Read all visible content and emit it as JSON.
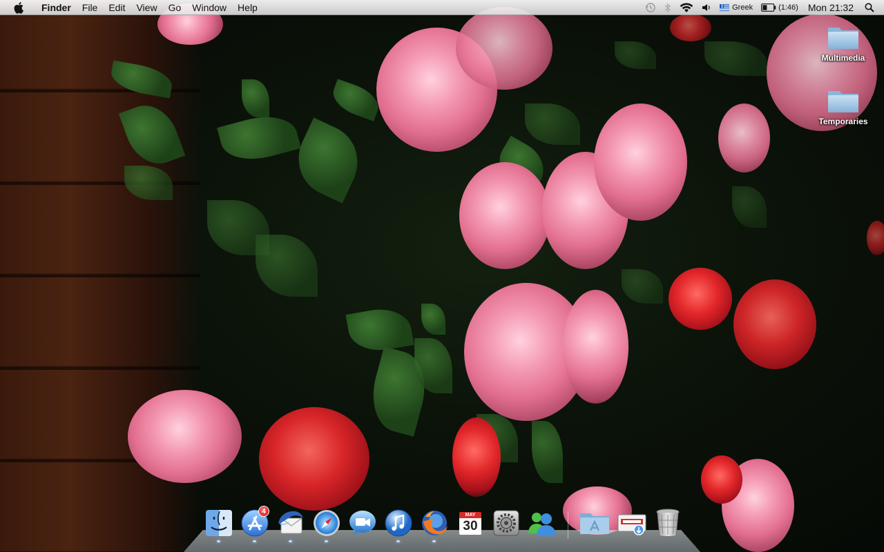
{
  "menubar": {
    "app_name": "Finder",
    "menus": [
      "File",
      "Edit",
      "View",
      "Go",
      "Window",
      "Help"
    ],
    "input_language": "Greek",
    "battery_time": "(1:46)",
    "clock": "Mon 21:32"
  },
  "desktop_icons": [
    {
      "label": "Multimedia",
      "icon": "folder-icon"
    },
    {
      "label": "Temporaries",
      "icon": "folder-icon"
    }
  ],
  "dock": {
    "apps": [
      {
        "name": "Finder",
        "icon": "finder-icon"
      },
      {
        "name": "App Store",
        "icon": "app-store-icon",
        "badge": "4"
      },
      {
        "name": "Thunderbird",
        "icon": "thunderbird-icon"
      },
      {
        "name": "Safari",
        "icon": "safari-icon"
      },
      {
        "name": "FaceTime",
        "icon": "facetime-icon"
      },
      {
        "name": "iTunes",
        "icon": "itunes-icon"
      },
      {
        "name": "Firefox",
        "icon": "firefox-icon"
      },
      {
        "name": "iCal",
        "icon": "calendar-icon",
        "month": "MAY",
        "day": "30"
      },
      {
        "name": "System Preferences",
        "icon": "system-preferences-icon"
      },
      {
        "name": "Messenger",
        "icon": "messenger-icon"
      }
    ],
    "stacks": [
      {
        "name": "Applications",
        "icon": "applications-folder-icon"
      },
      {
        "name": "Downloads",
        "icon": "downloads-stack-icon"
      },
      {
        "name": "Trash",
        "icon": "trash-icon"
      }
    ]
  }
}
